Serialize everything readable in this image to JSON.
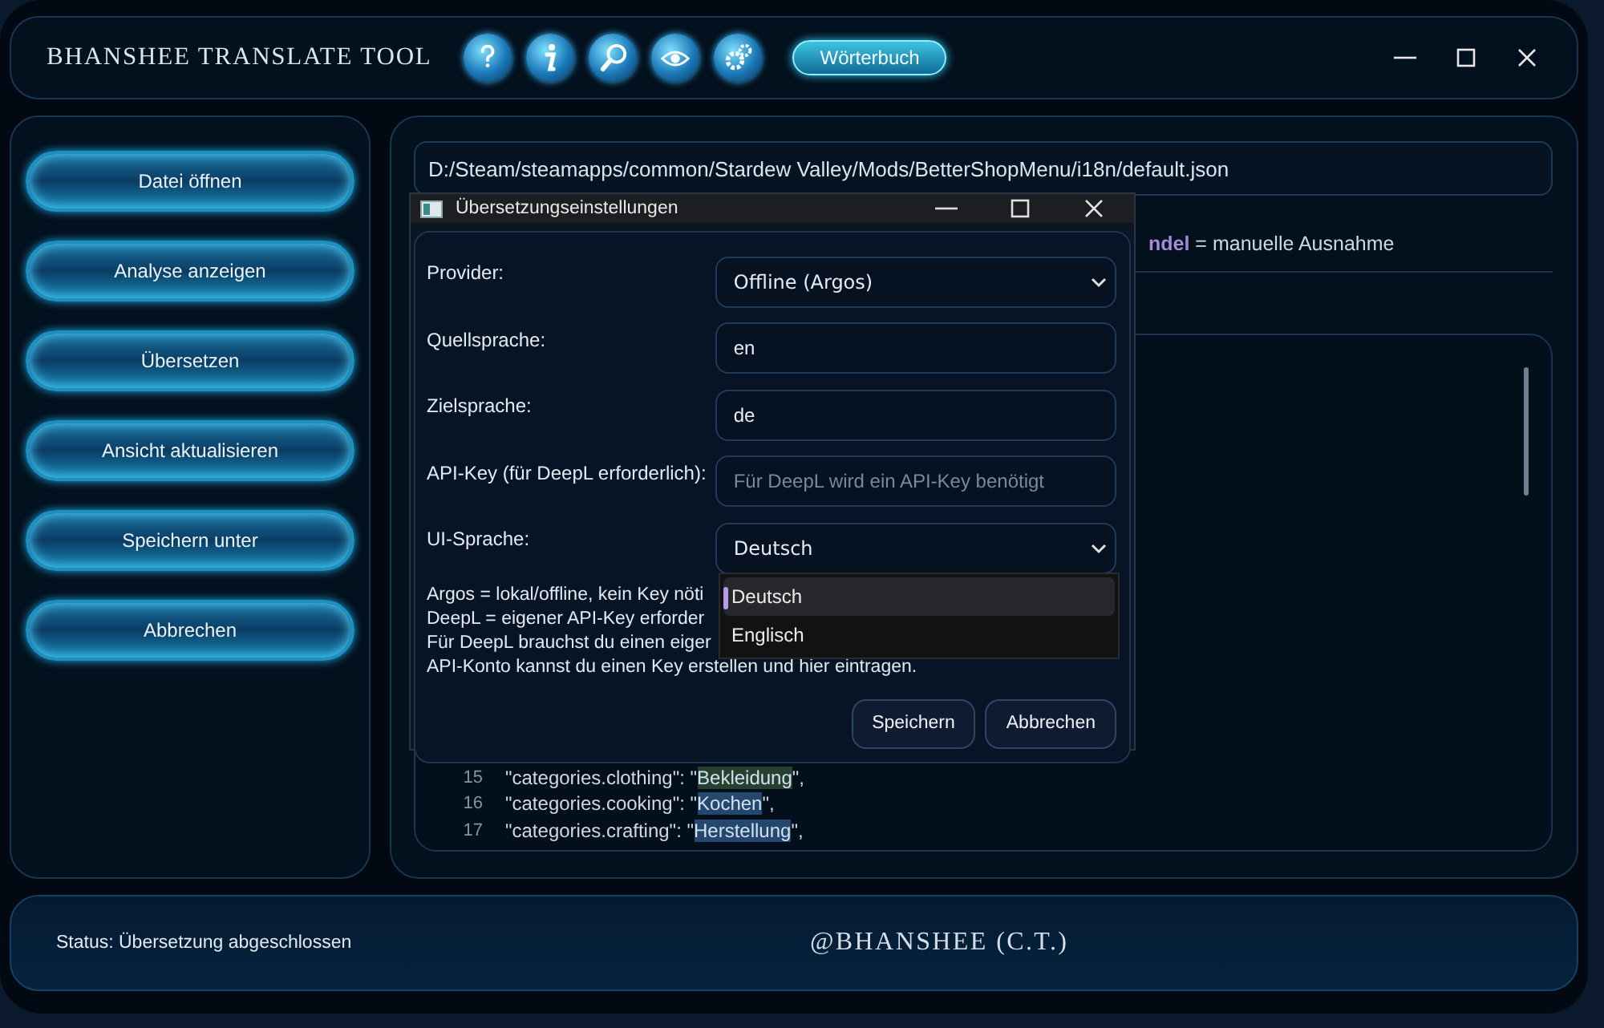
{
  "window": {
    "title": "BHANSHEE TRANSLATE TOOL",
    "controls": [
      {
        "kind": "minimize"
      },
      {
        "kind": "maximize"
      },
      {
        "kind": "close"
      }
    ]
  },
  "toolbar": {
    "icons": [
      {
        "kind": "help"
      },
      {
        "kind": "info"
      },
      {
        "kind": "search"
      },
      {
        "kind": "eye"
      },
      {
        "kind": "gear"
      }
    ],
    "dictionary_button": "Wörterbuch"
  },
  "sidebar": {
    "buttons": [
      "Datei öffnen",
      "Analyse anzeigen",
      "Übersetzen",
      "Ansicht aktualisieren",
      "Speichern unter",
      "Abbrechen"
    ]
  },
  "main": {
    "path": "D:/Steam/steamapps/common/Stardew Valley/Mods/BetterShopMenu/i18n/default.json",
    "legend": "**ndel** = manuelle Ausnahme",
    "editor": {
      "lines": [
        {
          "number": "15",
          "key": "\"categories.clothing\": \"",
          "value": "Bekleidung",
          "tail": "\",",
          "color": "#27402f"
        },
        {
          "number": "16",
          "key": "\"categories.cooking\": \"",
          "value": "Kochen",
          "tail": "\",",
          "color": "#25476e"
        },
        {
          "number": "17",
          "key": "\"categories.crafting\": \"",
          "value": "Herstellung",
          "tail": "\",",
          "color": "#25476e"
        }
      ]
    }
  },
  "status_bar": {
    "status": "Status: Übersetzung abgeschlossen",
    "credit": "@BHANSHEE (C.T.)"
  },
  "dialog": {
    "title": "Übersetzungseinstellungen",
    "controls": [
      {
        "kind": "minimize"
      },
      {
        "kind": "maximize"
      },
      {
        "kind": "close"
      }
    ],
    "fields": [
      {
        "label": "Provider:",
        "kind": "select",
        "value": "Offline (Argos)"
      },
      {
        "label": "Quellsprache:",
        "kind": "input",
        "value": "en"
      },
      {
        "label": "Zielsprache:",
        "kind": "input",
        "value": "de"
      },
      {
        "label": "API-Key (für DeepL erforderlich):",
        "kind": "input",
        "placeholder": "Für DeepL wird ein API-Key benötigt"
      },
      {
        "label": "UI-Sprache:",
        "kind": "select",
        "value": "Deutsch"
      }
    ],
    "help_lines": [
      "Argos = lokal/offline, kein Key nöti",
      "DeepL = eigener API-Key erforder",
      "Für DeepL brauchst du einen eiger",
      "API-Konto kannst du einen Key erstellen und hier eintragen."
    ],
    "dropdown_options": [
      {
        "label": "Deutsch",
        "selected": true
      },
      {
        "label": "Englisch",
        "selected": false
      }
    ],
    "buttons": [
      "Speichern",
      "Abbrechen"
    ]
  }
}
